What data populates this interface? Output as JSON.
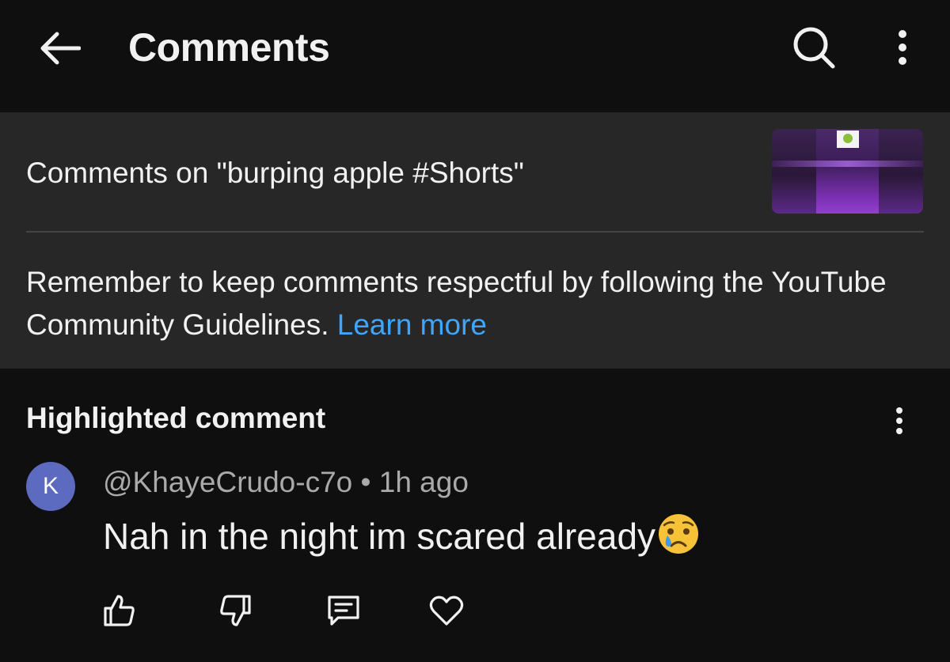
{
  "header": {
    "title": "Comments"
  },
  "info": {
    "video_comments_label": "Comments on \"burping apple #Shorts\"",
    "guidelines_text": "Remember to keep comments respectful by following the YouTube Community Guidelines.",
    "learn_more": "Learn more"
  },
  "highlighted": {
    "header": "Highlighted comment",
    "avatar_letter": "K",
    "author": "@KhayeCrudo-c7o",
    "separator": " • ",
    "time": "1h ago",
    "text": "Nah in the night im scared already",
    "emoji": "crying-face-emoji"
  },
  "icons": {
    "back": "back-arrow-icon",
    "search": "search-icon",
    "more": "more-vert-icon",
    "like": "thumbs-up-icon",
    "dislike": "thumbs-down-icon",
    "reply": "reply-icon",
    "heart": "heart-icon"
  },
  "colors": {
    "background": "#0f0f0f",
    "panel": "#272727",
    "link": "#3ea6ff",
    "avatar": "#5c6bc0",
    "muted_text": "#aaaaaa"
  }
}
